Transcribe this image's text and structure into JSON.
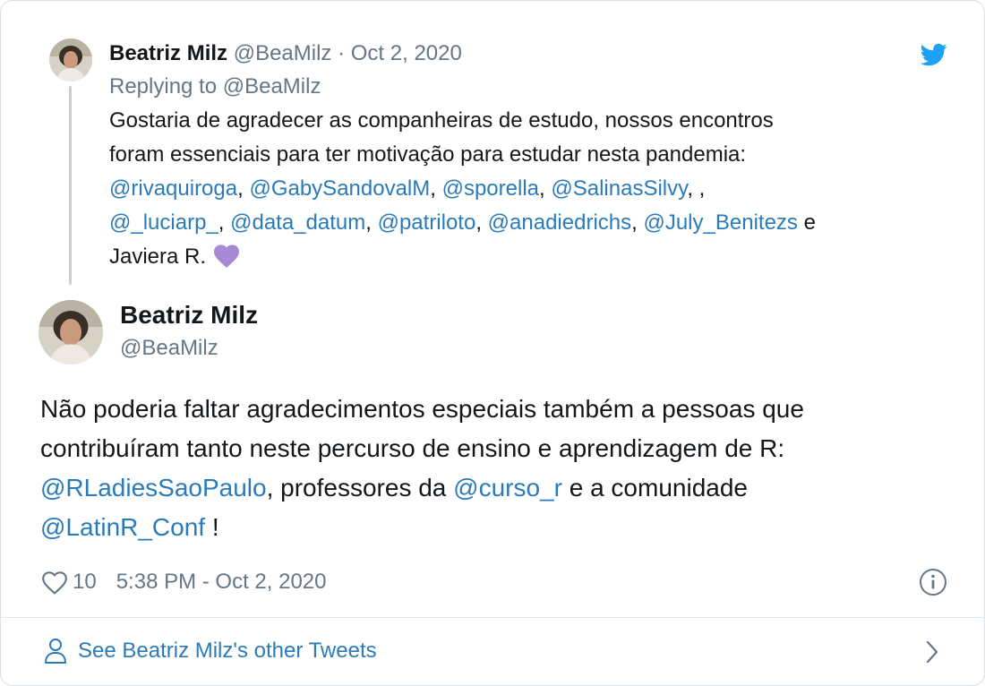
{
  "parent_tweet": {
    "author_name": "Beatriz Milz",
    "meta": "@BeaMilz · Oct 2, 2020",
    "replying_to": "Replying to @BeaMilz",
    "text_line1": "Gostaria de agradecer as companheiras de estudo, nossos encontros",
    "text_line2": "foram essenciais para ter motivação para estudar nesta pandemia:",
    "line3": {
      "m1": "@rivaquiroga",
      "s1": ",  ",
      "m2": "@GabySandovalM",
      "s2": ", ",
      "m3": "@sporella",
      "s3": ", ",
      "m4": "@SalinasSilvy",
      "s4": ", ,"
    },
    "line4": {
      "m1": "@_luciarp_",
      "s1": ",  ",
      "m2": "@data_datum",
      "s2": ", ",
      "m3": "@patriloto",
      "s3": ", ",
      "m4": "@anadiedrichs",
      "s4": ", ",
      "m5": "@July_Benitezs",
      "s5": " e"
    },
    "text_line5": "Javiera R.",
    "emoji": "purple-heart"
  },
  "main_tweet": {
    "author_name": "Beatriz Milz",
    "handle": "@BeaMilz",
    "text_line1": "Não poderia faltar agradecimentos especiais também a pessoas que",
    "text_line2": "contribuíram tanto neste percurso de ensino e aprendizagem de R:",
    "line3": {
      "m1": "@RLadiesSaoPaulo",
      "s1": ", professores da ",
      "m2": "@curso_r",
      "s2": " e a comunidade"
    },
    "line4": {
      "m1": "@LatinR_Conf",
      "s1": " !"
    },
    "like_count": "10",
    "timestamp": "5:38 PM - Oct 2, 2020"
  },
  "see_more": {
    "label": "See Beatriz Milz's other Tweets"
  },
  "icons": {
    "logo": "twitter-bird-icon",
    "like": "heart-outline-icon",
    "info": "info-icon",
    "person": "person-icon",
    "chevron": "chevron-right-icon"
  },
  "colors": {
    "link": "#2b7bb9",
    "twitter_blue": "#1da1f2",
    "muted": "#657786",
    "text": "#14171a",
    "emoji_heart": "#a78ad3"
  }
}
